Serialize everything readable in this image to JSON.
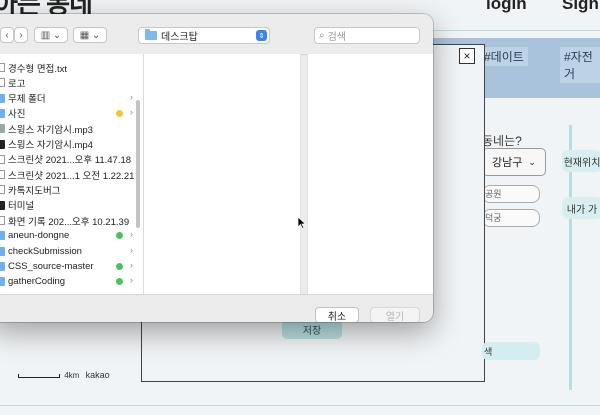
{
  "background": {
    "site_title": "아는 동네",
    "nav": {
      "login": "login",
      "sign": "Sign"
    },
    "tags": [
      "#데이트",
      "#자전거"
    ],
    "question": "동네는?",
    "district_select": "강남구",
    "pills": {
      "current_location": "현재위치",
      "my_location": "내가 가"
    },
    "fields": [
      "공원",
      "덕궁"
    ],
    "save_label": "저장",
    "search_label": "색",
    "scale": {
      "distance": "4km",
      "provider": "kakao"
    },
    "modal_close": "×"
  },
  "dialog": {
    "location": "데스크탑",
    "search_placeholder": "검색",
    "files": [
      {
        "name": "경수형 면접.txt",
        "type": "doc"
      },
      {
        "name": "로고",
        "type": "doc"
      },
      {
        "name": "무제 폴더",
        "type": "folder",
        "chevron": true
      },
      {
        "name": "사진",
        "type": "folder",
        "tag": "#f5c431",
        "chevron": true
      },
      {
        "name": "스윙스 자기암시.mp3",
        "type": "media"
      },
      {
        "name": "스윙스 자기암시.mp4",
        "type": "term"
      },
      {
        "name": "스크린샷 2021...오후 11.47.18",
        "type": "doc"
      },
      {
        "name": "스크린샷 2021...1 오전 1.22.21",
        "type": "doc"
      },
      {
        "name": "카톡지도버그",
        "type": "doc"
      },
      {
        "name": "터미널",
        "type": "term"
      },
      {
        "name": "화면 기록 202...오후 10.21.39",
        "type": "doc"
      },
      {
        "name": "aneun-dongne",
        "type": "folder",
        "tag": "#4cc25e",
        "chevron": true
      },
      {
        "name": "checkSubmission",
        "type": "folder",
        "chevron": true
      },
      {
        "name": "CSS_source-master",
        "type": "folder",
        "tag": "#4cc25e",
        "chevron": true
      },
      {
        "name": "gatherCoding",
        "type": "folder",
        "tag": "#4cc25e",
        "chevron": true
      }
    ],
    "cancel_label": "취소",
    "open_label": "열기",
    "colors": {
      "accent": "#3b82f6",
      "folder": "#6eb0f0"
    }
  }
}
